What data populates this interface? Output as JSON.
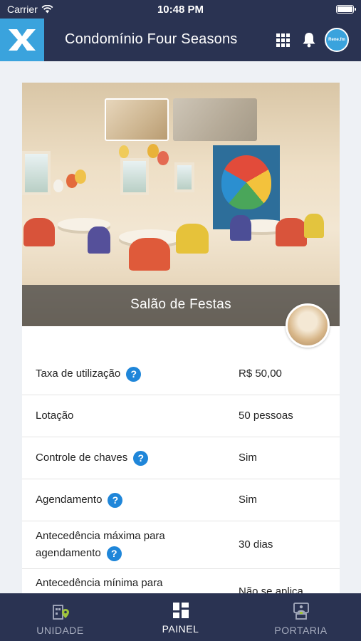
{
  "status_bar": {
    "carrier": "Carrier",
    "time": "10:48 PM"
  },
  "header": {
    "title": "Condomínio Four Seasons",
    "avatar_text": "Rene.fm"
  },
  "amenity": {
    "name": "Salão de Festas",
    "details": [
      {
        "label": "Taxa de utilização",
        "value": "R$ 50,00",
        "help": true
      },
      {
        "label": "Lotação",
        "value": "50 pessoas",
        "help": false
      },
      {
        "label": "Controle de chaves",
        "value": "Sim",
        "help": true
      },
      {
        "label": "Agendamento",
        "value": "Sim",
        "help": true
      },
      {
        "label": "Antecedência máxima para",
        "label2": "agendamento",
        "value": "30 dias",
        "help": true
      },
      {
        "label": "Antecedência mínima para",
        "value": "Não se aplica",
        "help": false
      }
    ]
  },
  "tabs": [
    {
      "label": "UNIDADE",
      "icon": "building-pin-icon"
    },
    {
      "label": "PAINEL",
      "icon": "dashboard-grid-icon"
    },
    {
      "label": "PORTARIA",
      "icon": "concierge-icon"
    }
  ],
  "colors": {
    "navy": "#2a3352",
    "accent": "#3aa3dd",
    "help": "#1f86d9"
  }
}
